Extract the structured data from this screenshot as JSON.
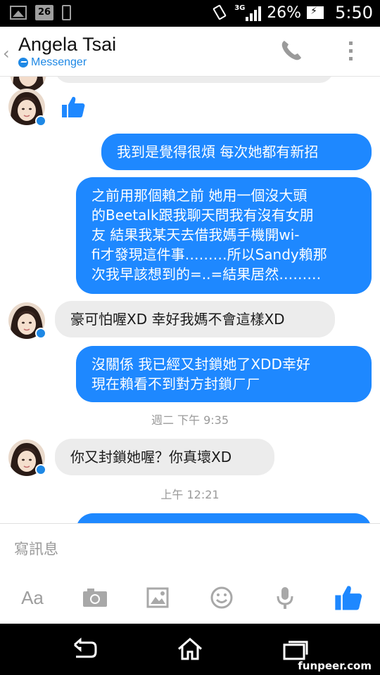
{
  "status_bar": {
    "calendar_day": "26",
    "network_type": "3G",
    "battery_percent": "26%",
    "time": "5:50"
  },
  "header": {
    "contact_name": "Angela Tsai",
    "subtitle": "Messenger",
    "back_icon": "chevron-left-icon",
    "call_icon": "phone-icon",
    "more_icon": "overflow-menu-icon"
  },
  "messages": [
    {
      "direction": "out",
      "text": "我到是覺得很煩 每次她都有新招"
    },
    {
      "direction": "out",
      "lines": [
        "之前用那個賴之前 她用一個沒大頭",
        "的Beetalk跟我聊天問我有沒有女朋",
        "友 結果我某天去借我媽手機開wi-",
        "fi才發現這件事………所以Sandy賴那",
        "次我早該想到的=..=結果居然………"
      ]
    },
    {
      "direction": "in",
      "text": "豪可怕喔XD 幸好我媽不會這樣XD"
    },
    {
      "direction": "out",
      "lines": [
        "沒關係 我已經又封鎖她了XDD幸好",
        "現在賴看不到對方封鎖ㄏㄏ"
      ]
    },
    {
      "direction": "in",
      "text": "你又封鎖她喔？你真壞XD"
    }
  ],
  "timestamps": {
    "first": "週二 下午 9:35",
    "second": "上午 12:21"
  },
  "composer": {
    "placeholder": "寫訊息",
    "tools": [
      "text-format",
      "camera-icon",
      "gallery-icon",
      "emoji-icon",
      "microphone-icon",
      "thumbs-up-icon"
    ],
    "text_format_label": "Aa"
  },
  "navbar": {
    "buttons": [
      "back-icon",
      "home-icon",
      "recent-apps-icon"
    ]
  },
  "watermark": "funpeer.com",
  "colors": {
    "outgoing_bubble": "#1e88ff",
    "incoming_bubble": "#ececec",
    "accent": "#1e88e5"
  }
}
